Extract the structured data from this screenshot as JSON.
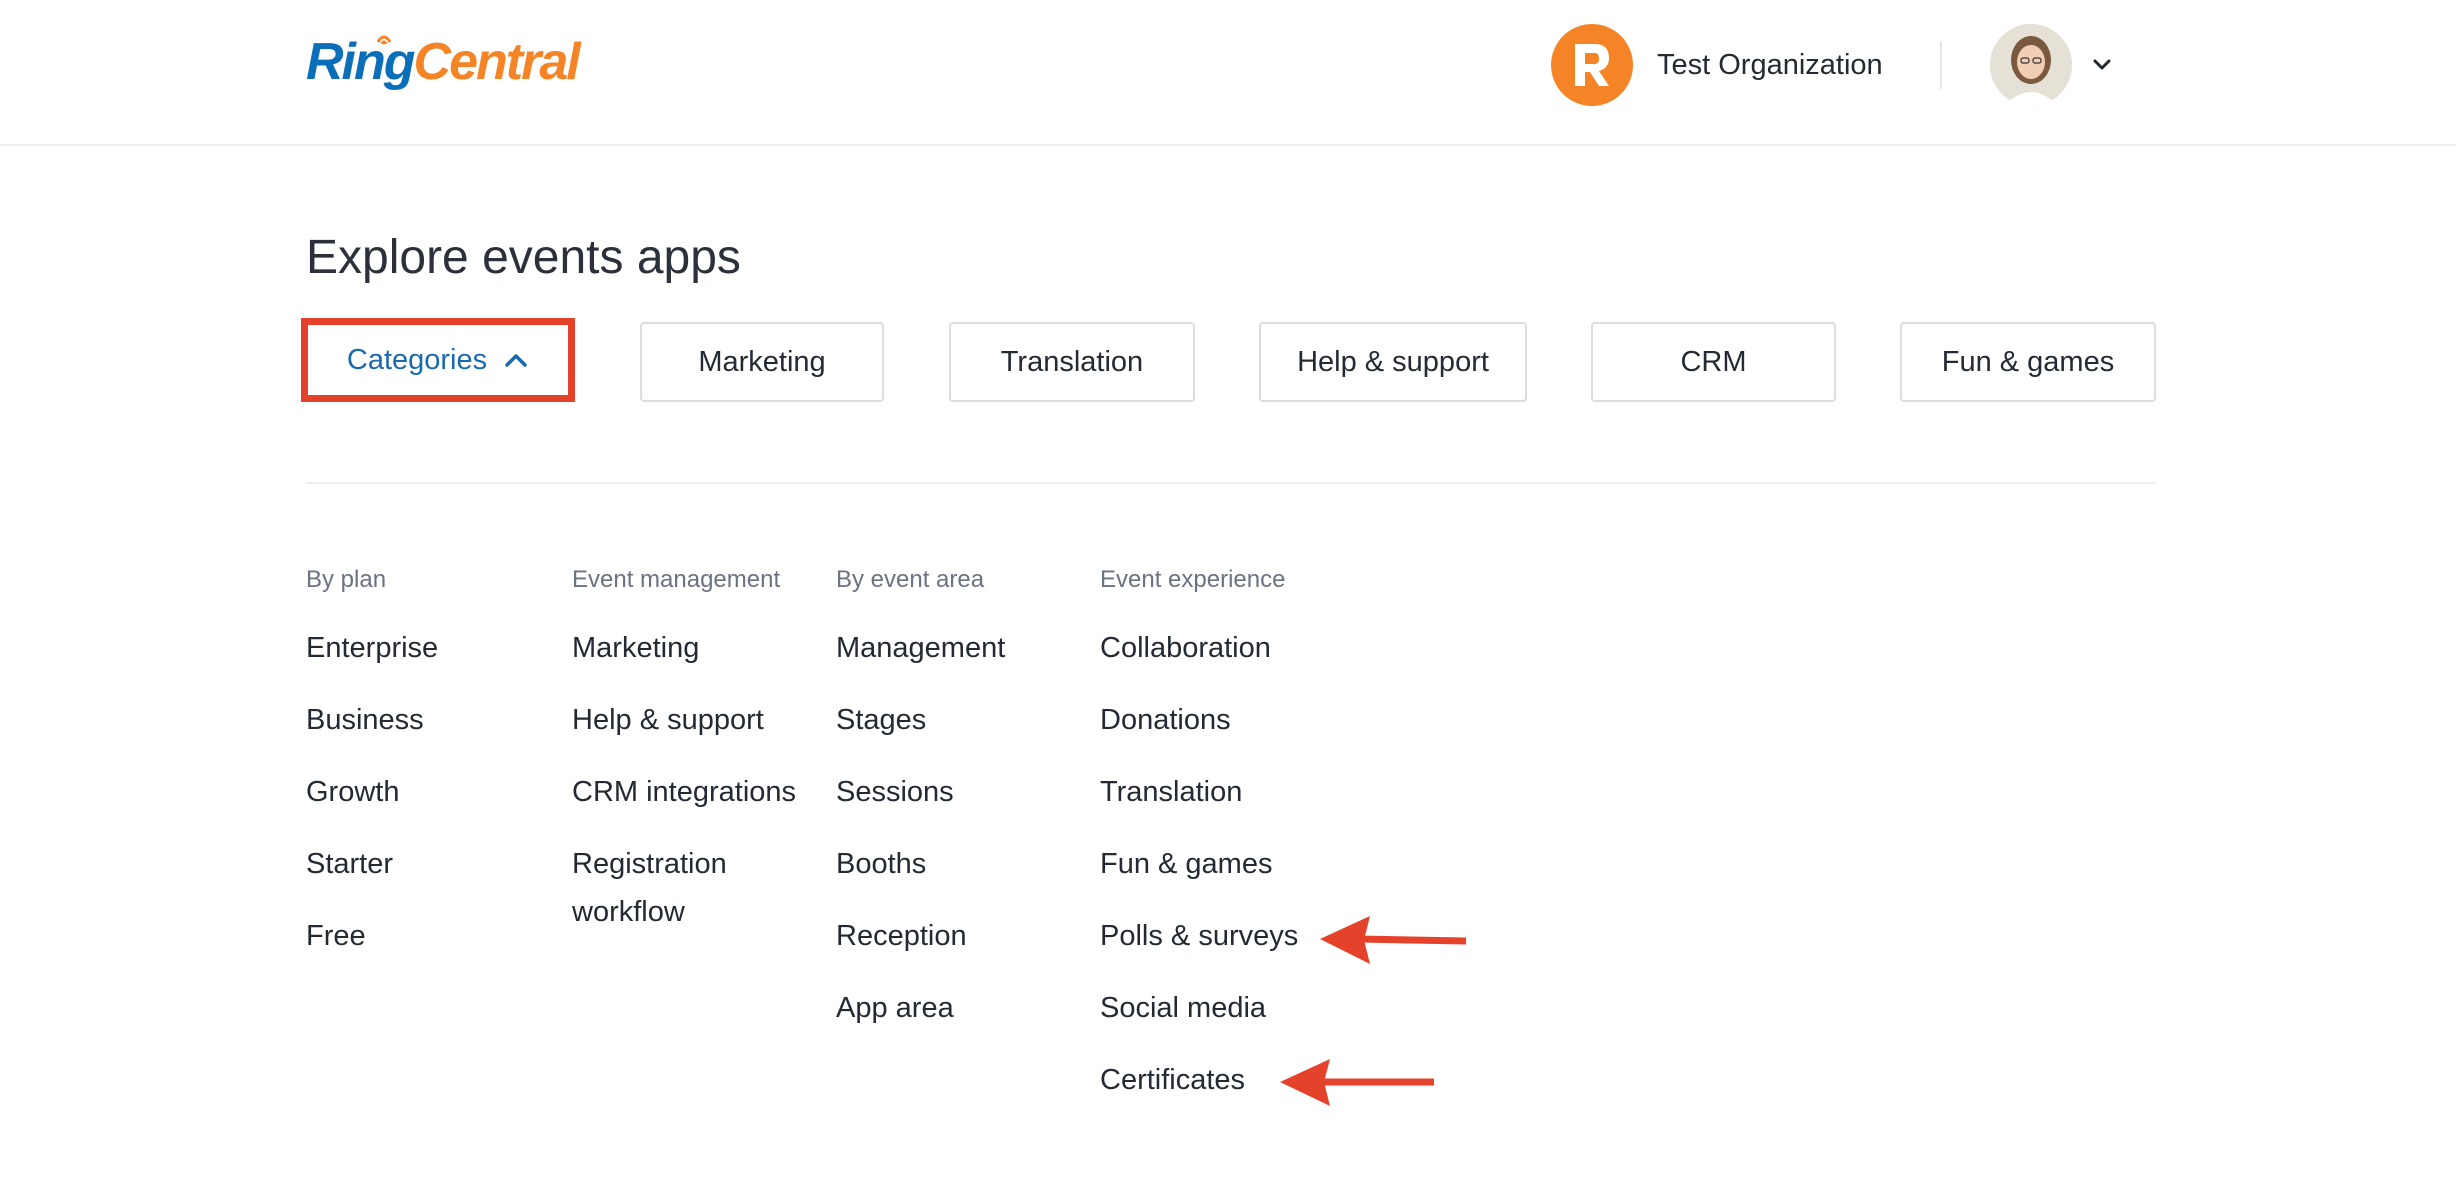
{
  "header": {
    "logo_ring": "Ring",
    "logo_central": "Central",
    "org_name": "Test Organization",
    "org_avatar_letter": "R"
  },
  "page_title": "Explore events apps",
  "tabs": {
    "categories": "Categories",
    "items": [
      "Marketing",
      "Translation",
      "Help & support",
      "CRM",
      "Fun & games"
    ]
  },
  "columns": [
    {
      "title": "By plan",
      "items": [
        "Enterprise",
        "Business",
        "Growth",
        "Starter",
        "Free"
      ]
    },
    {
      "title": "Event management",
      "items": [
        "Marketing",
        "Help & support",
        "CRM integrations",
        "Registration workflow"
      ]
    },
    {
      "title": "By event area",
      "items": [
        "Management",
        "Stages",
        "Sessions",
        "Booths",
        "Reception",
        "App area"
      ]
    },
    {
      "title": "Event experience",
      "items": [
        "Collaboration",
        "Donations",
        "Translation",
        "Fun & games",
        "Polls & surveys",
        "Social media",
        "Certificates"
      ]
    }
  ],
  "colors": {
    "accent_orange": "#f58426",
    "brand_blue": "#0a6fb8",
    "highlight_red": "#e5422b"
  }
}
